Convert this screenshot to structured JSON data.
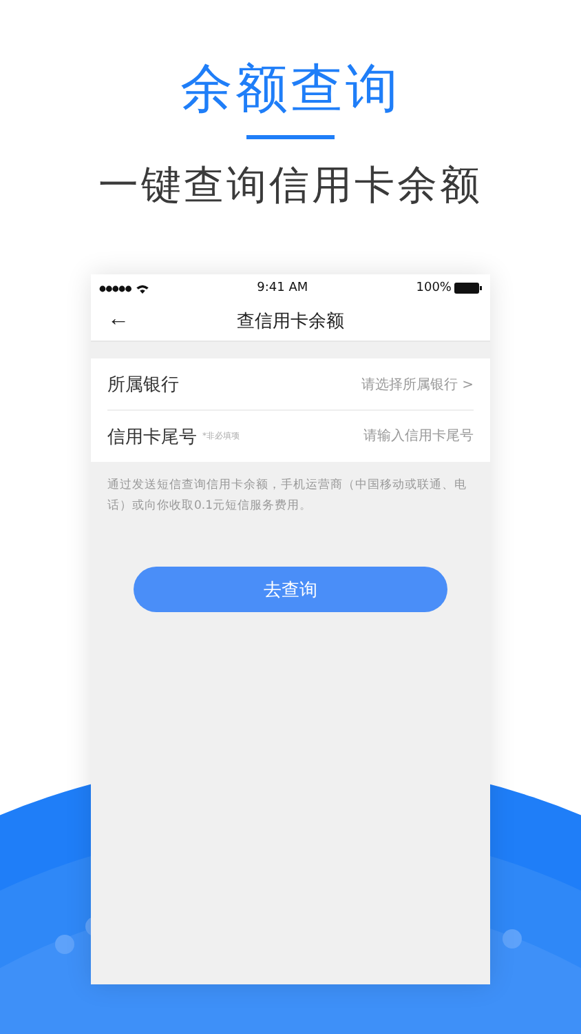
{
  "headline": {
    "title": "余额查询",
    "subtitle": "一键查询信用卡余额"
  },
  "phone": {
    "status_bar": {
      "time": "9:41 AM",
      "battery": "100%"
    },
    "nav": {
      "back": "←",
      "title": "查信用卡余额"
    },
    "form_rows": [
      {
        "kind": "select",
        "label": "所属银行",
        "placeholder": "请选择所属银行",
        "chevron": ">"
      },
      {
        "kind": "input",
        "label": "信用卡尾号",
        "hint": "*非必填项",
        "placeholder": "请输入信用卡尾号"
      }
    ],
    "note": "通过发送短信查询信用卡余额，手机运营商（中国移动或联通、电话）或向你收取0.1元短信服务费用。",
    "button": "去查询"
  }
}
